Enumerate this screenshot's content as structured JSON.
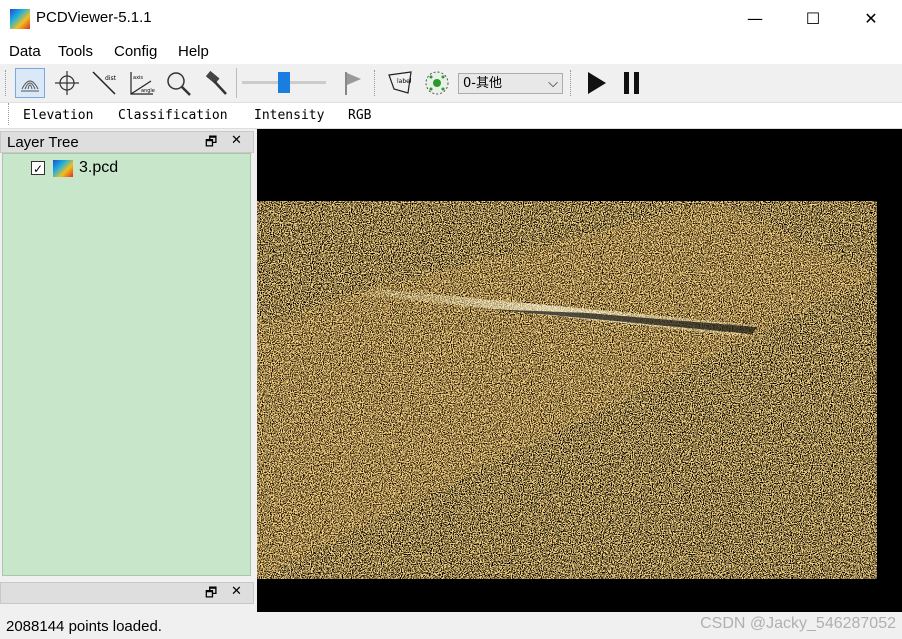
{
  "window": {
    "title": "PCDViewer-5.1.1",
    "minimize_glyph": "—",
    "maximize_glyph": "☐",
    "close_glyph": "✕"
  },
  "menu": [
    "Data",
    "Tools",
    "Config",
    "Help"
  ],
  "toolbar": {
    "icons": [
      "rotate-icon",
      "crosshair-icon",
      "distance-icon",
      "angle-icon",
      "zoom-icon",
      "hammer-icon",
      "flag-icon",
      "label-icon",
      "point-select-icon",
      "play-icon",
      "pause-icon"
    ],
    "distance_text": "dist",
    "angle_text_top": "axis",
    "angle_text_bottom": "angle",
    "label_text": "label",
    "slider_value_percent": 50,
    "class_select": "0-其他",
    "combo_arrow": "⌵"
  },
  "color_modes": [
    "Elevation",
    "Classification",
    "Intensity",
    "RGB"
  ],
  "layer_panel": {
    "title": "Layer Tree",
    "float_glyph": "🗗",
    "close_glyph": "✕",
    "layers": [
      {
        "name": "3.pcd",
        "checked": "✓"
      }
    ]
  },
  "lower_panel": {
    "float_glyph": "🗗",
    "close_glyph": "✕"
  },
  "status": {
    "text": "2088144 points loaded.",
    "watermark": "CSDN @Jacky_546287052"
  },
  "colors": {
    "layer_tree_bg": "#c8e6c9",
    "viewport_bg": "#000000",
    "points": "#e0a030",
    "accent": "#1a7de0"
  }
}
